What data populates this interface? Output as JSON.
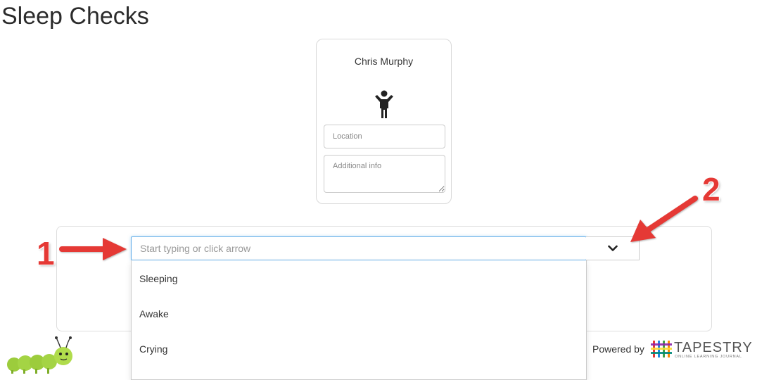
{
  "page": {
    "title": "Sleep Checks"
  },
  "child_card": {
    "name": "Chris Murphy",
    "icon": "child-icon",
    "location_placeholder": "Location",
    "additional_info_placeholder": "Additional info"
  },
  "status_selector": {
    "placeholder": "Start typing or click arrow",
    "toggle_icon": "chevron-down-icon",
    "options": [
      {
        "label": "Sleeping"
      },
      {
        "label": "Awake"
      },
      {
        "label": "Crying"
      }
    ]
  },
  "footer": {
    "powered_by": "Powered by",
    "brand": "TAPESTRY",
    "brand_tagline": "ONLINE LEARNING JOURNAL",
    "mascot": "caterpillar-mascot"
  },
  "annotations": {
    "step_1": "1",
    "step_2": "2",
    "arrow_color": "#e53935"
  },
  "colors": {
    "focus_border": "#66afe9",
    "text": "#333333"
  }
}
